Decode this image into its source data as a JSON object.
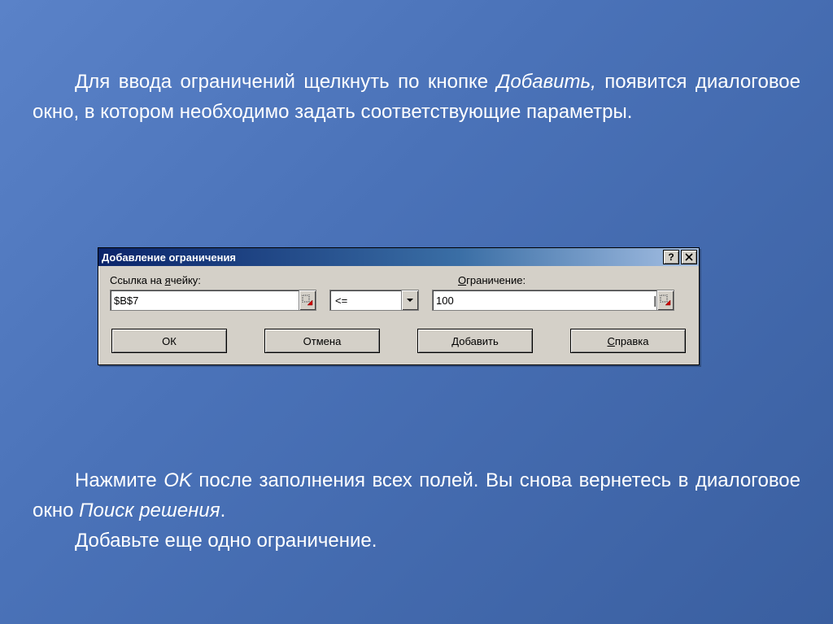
{
  "text": {
    "top_full": "Для ввода ограничений щелкнуть по кнопке Добавить, появится диалоговое окно, в котором необходимо задать соответствующие параметры.",
    "top_lead": "Для ввода ограничений щелкнуть по кнопке ",
    "top_em": "Добавить,",
    "top_rest": " появится диалоговое окно, в котором необходимо задать соответствующие параметры.",
    "bottom_a_lead": "Нажмите ",
    "bottom_a_em": "OK",
    "bottom_a_mid": " после заполнения всех полей. Вы снова вернетесь в диалоговое окно ",
    "bottom_a_em2": "Поиск решения",
    "bottom_a_end": ".",
    "bottom_b": "Добавьте еще одно ограничение."
  },
  "dialog": {
    "title": "Добавление ограничения",
    "labels": {
      "cell_prefix": "Ссылка на ",
      "cell_ul": "я",
      "cell_suffix": "чейку:",
      "limit_ul": "О",
      "limit_suffix": "граничение:"
    },
    "fields": {
      "cell_ref": "$B$7",
      "operator": "<=",
      "limit": "100"
    },
    "buttons": {
      "ok": "ОК",
      "cancel": "Отмена",
      "add_ul": "Д",
      "add_rest": "обавить",
      "help_ul": "С",
      "help_rest": "правка"
    }
  }
}
